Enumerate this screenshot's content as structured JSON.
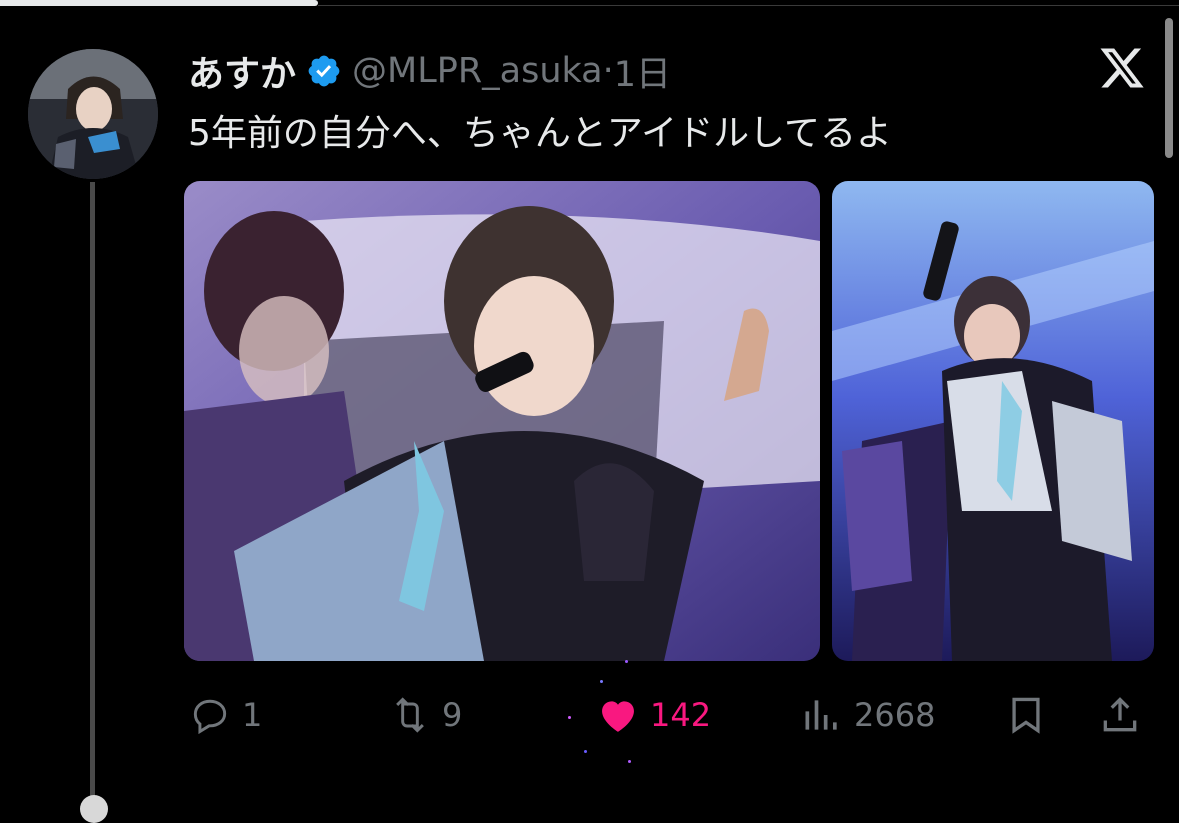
{
  "post": {
    "author_name": "あすか",
    "handle": "@MLPR_asuka",
    "separator": "·",
    "time": "1日",
    "text": "5年前の自分へ、ちゃんとアイドルしてるよ"
  },
  "actions": {
    "replies": "1",
    "reposts": "9",
    "likes": "142",
    "views": "2668"
  },
  "icons": {
    "verified": "verified-badge-icon",
    "brand": "x-logo-icon",
    "reply": "reply-icon",
    "repost": "repost-icon",
    "like": "heart-icon",
    "views": "views-icon",
    "bookmark": "bookmark-icon",
    "share": "share-icon"
  },
  "colors": {
    "background": "#000000",
    "text": "#e7e9ea",
    "muted": "#71767b",
    "like": "#f91880",
    "verified": "#1d9bf0"
  }
}
